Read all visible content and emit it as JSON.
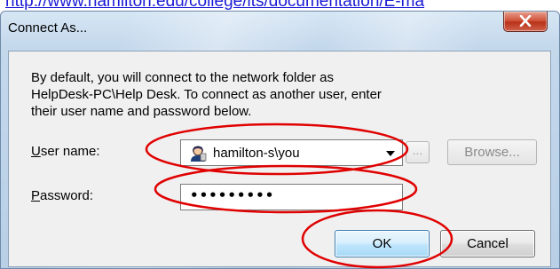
{
  "browser": {
    "url_text": "http://www.hamilton.edu/college/its/documentation/E-ma"
  },
  "dialog": {
    "title": "Connect As...",
    "close_icon": "close-x-icon",
    "description_lines": [
      "By default, you will connect to the network folder as",
      "HelpDesk-PC\\Help Desk. To connect as another user, enter",
      "their user name and password below."
    ],
    "user_name": {
      "label_mnemonic": "U",
      "label_rest": "ser name:",
      "value": "hamilton-s\\you",
      "icon": "user-account-icon",
      "dropdown_icon": "chevron-down-icon"
    },
    "ellipsis_button": "...",
    "browse_button": "Browse...",
    "password": {
      "label_mnemonic": "P",
      "label_rest": "assword:",
      "masked_value": "•••••••••"
    },
    "ok_button": "OK",
    "cancel_button": "Cancel"
  },
  "annotations": {
    "color": "#e00000",
    "shape": "ellipse",
    "targets": [
      "user-name-combobox",
      "password-input",
      "ok-button"
    ]
  }
}
